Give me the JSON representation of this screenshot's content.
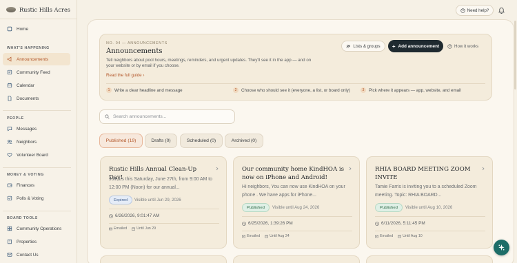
{
  "brand": {
    "name": "Rustic Hills Acres",
    "logo_icon": "house-logo"
  },
  "topbar": {
    "help_label": "Need help?",
    "bell_icon": "bell-icon"
  },
  "sidebar": {
    "home": "Home",
    "section_happening": "WHAT'S HAPPENING",
    "announcements": "Announcements",
    "community_feed": "Community Feed",
    "calendar": "Calendar",
    "documents": "Documents",
    "section_people": "PEOPLE",
    "messages": "Messages",
    "neighbors": "Neighbors",
    "volunteer_board": "Volunteer Board",
    "section_money": "MONEY & VOTING",
    "finances": "Finances",
    "polls_voting": "Polls & Voting",
    "section_board": "BOARD TOOLS",
    "community_operations": "Community Operations",
    "properties": "Properties",
    "contact_us": "Contact Us"
  },
  "header": {
    "eyebrow": "NO. 04 — ANNOUNCEMENTS",
    "title": "Announcements",
    "description": "Tell neighbors about pool hours, meetings, reminders, and urgent updates. They'll see it in the app — and on your website or by email if you choose.",
    "guide_link": "Read the full guide",
    "lists_button": "Lists & groups",
    "add_button": "Add announcement",
    "how_button": "How it works",
    "steps": [
      {
        "num": "1",
        "text": "Write a clear headline and message"
      },
      {
        "num": "2",
        "text": "Choose who should see it (everyone, a list, or board only)"
      },
      {
        "num": "3",
        "text": "Pick where it appears — app, website, and email"
      }
    ]
  },
  "search": {
    "placeholder": "Search announcements...",
    "value": ""
  },
  "tabs": [
    {
      "label": "Published (19)",
      "active": true
    },
    {
      "label": "Drafts (0)",
      "active": false
    },
    {
      "label": "Scheduled (0)",
      "active": false
    },
    {
      "label": "Archived (0)",
      "active": false
    }
  ],
  "cards": [
    {
      "title": "Rustic Hills Annual Clean-Up Day!",
      "body": "Join us this Saturday, June 27th, from 9:00 AM to 12:00 PM (Noon) for our annual...",
      "status": "Expired",
      "visible": "Visible until Jun 29, 2026",
      "date": "6/26/2026, 9:01:47 AM",
      "emailed": "Emailed",
      "until": "Until Jun 29"
    },
    {
      "title": "Our community home KindHOA is now on iPhone and Android!",
      "body": "Hi neighbors, You can now use KindHOA on your phone . We have apps for iPhone...",
      "status": "Published",
      "visible": "Visible until Aug 24, 2026",
      "date": "6/25/2026, 1:39:26 PM",
      "emailed": "Emailed",
      "until": "Until Aug 24"
    },
    {
      "title": "RHIA BOARD MEETING ZOOM INVITE",
      "body": "Tamie Farris is inviting you to a scheduled Zoom meeting. Topic: RHIA BOARD...",
      "status": "Published",
      "visible": "Visible until Aug 10, 2026",
      "date": "6/11/2026, 5:11:45 PM",
      "emailed": "Emailed",
      "until": "Until Aug 10"
    }
  ],
  "colors": {
    "accent": "#b3582b",
    "primary_dark": "#1f2a30",
    "fab": "#1d6d68",
    "background": "#f6f1e6"
  }
}
